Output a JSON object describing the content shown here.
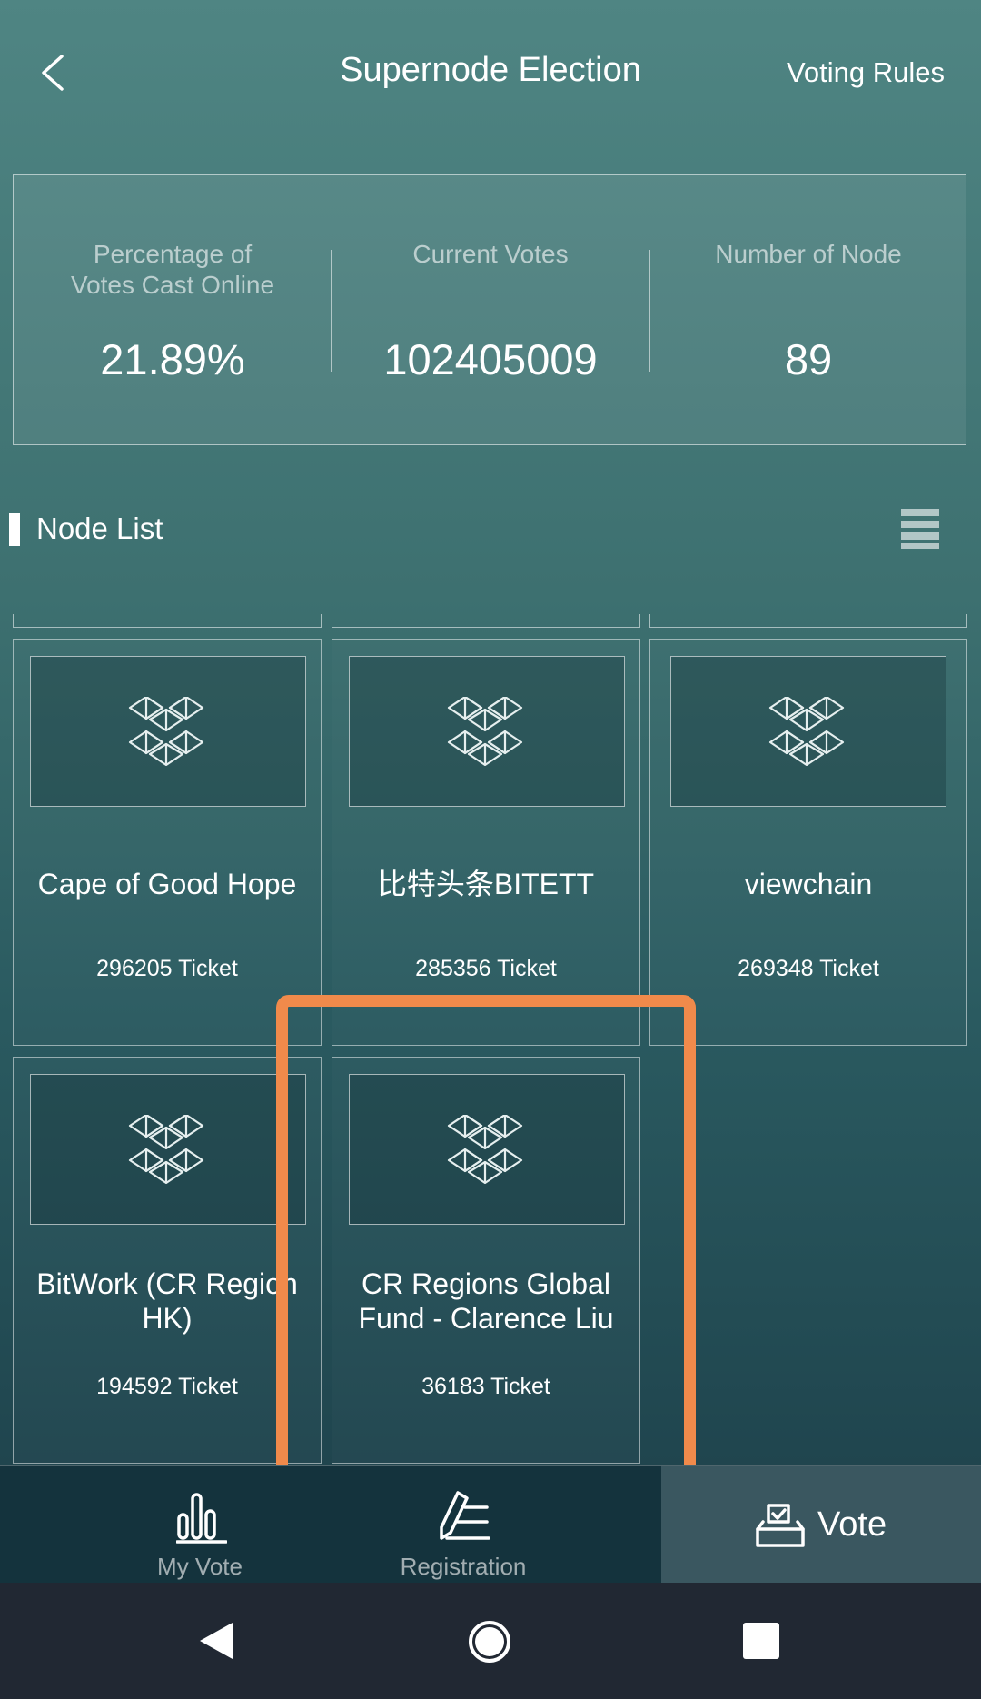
{
  "header": {
    "title": "Supernode Election",
    "rules_label": "Voting Rules"
  },
  "stats": [
    {
      "label": "Percentage of Votes Cast Online",
      "value": "21.89%"
    },
    {
      "label": "Current Votes",
      "value": "102405009"
    },
    {
      "label": "Number of Node",
      "value": "89"
    }
  ],
  "node_list": {
    "title": "Node List",
    "cards": [
      {
        "name": "Cape of Good Hope",
        "tickets": "296205 Ticket"
      },
      {
        "name": "比特头条BITETT",
        "tickets": "285356 Ticket"
      },
      {
        "name": "viewchain",
        "tickets": "269348 Ticket"
      },
      {
        "name": "BitWork (CR Region HK)",
        "tickets": "194592 Ticket"
      },
      {
        "name": "CR Regions Global Fund - Clarence Liu",
        "tickets": "36183 Ticket"
      }
    ]
  },
  "tabs": {
    "my_vote": "My Vote",
    "registration": "Registration",
    "vote": "Vote"
  },
  "colors": {
    "highlight": "#f08a4b",
    "tabbar": "#14333d",
    "vote_tab": "#3a5760"
  },
  "icons": [
    "back-arrow-icon",
    "list-menu-icon",
    "node-logo-icon",
    "bar-chart-icon",
    "edit-pen-icon",
    "ballot-box-icon",
    "nav-back-icon",
    "nav-home-icon",
    "nav-recents-icon"
  ]
}
